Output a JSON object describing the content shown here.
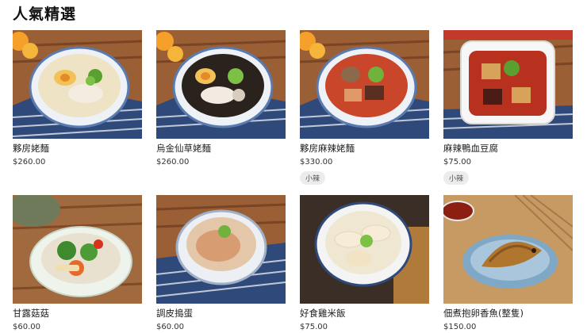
{
  "section": {
    "title": "人氣精選"
  },
  "items": [
    {
      "name": "夥房姥麵",
      "price": "$260.00",
      "tag": "",
      "image": "chicken-ramen-photo"
    },
    {
      "name": "烏金仙草姥麵",
      "price": "$260.00",
      "tag": "",
      "image": "black-broth-ramen-photo"
    },
    {
      "name": "夥房麻辣姥麵",
      "price": "$330.00",
      "tag": "小辣",
      "image": "spicy-ramen-photo"
    },
    {
      "name": "麻辣鴨血豆腐",
      "price": "$75.00",
      "tag": "小辣",
      "image": "duck-blood-tofu-photo"
    },
    {
      "name": "甘露菇菇",
      "price": "$60.00",
      "tag": "",
      "image": "mushroom-salad-photo"
    },
    {
      "name": "調皮搗蛋",
      "price": "$60.00",
      "tag": "",
      "image": "egg-bonito-photo"
    },
    {
      "name": "好食雞米飯",
      "price": "$75.00",
      "tag": "",
      "image": "chicken-rice-photo"
    },
    {
      "name": "佃煮抱卵香魚(整隻)",
      "price": "$150.00",
      "tag": "",
      "image": "sweetfish-photo"
    }
  ]
}
